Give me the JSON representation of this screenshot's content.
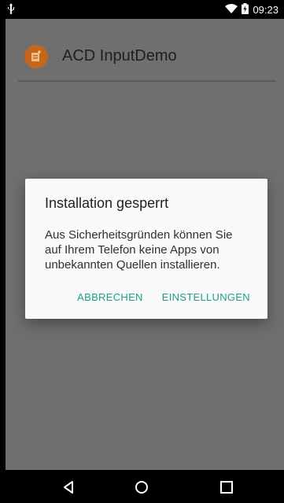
{
  "status_bar": {
    "time": "09:23",
    "icons": [
      "usb-icon",
      "wifi-icon",
      "battery-icon"
    ]
  },
  "app": {
    "title": "ACD InputDemo",
    "icon": "app-document-plus-icon",
    "icon_color": "#c5661a"
  },
  "dialog": {
    "title": "Installation gesperrt",
    "message": "Aus Sicherheitsgründen können Sie auf Ihrem Telefon keine Apps von unbekannten Quellen installieren.",
    "cancel_label": "ABBRECHEN",
    "settings_label": "EINSTELLUNGEN",
    "accent_color": "#1a9f8c"
  },
  "nav_bar": {
    "buttons": [
      "back-icon",
      "home-icon",
      "recents-icon"
    ]
  }
}
